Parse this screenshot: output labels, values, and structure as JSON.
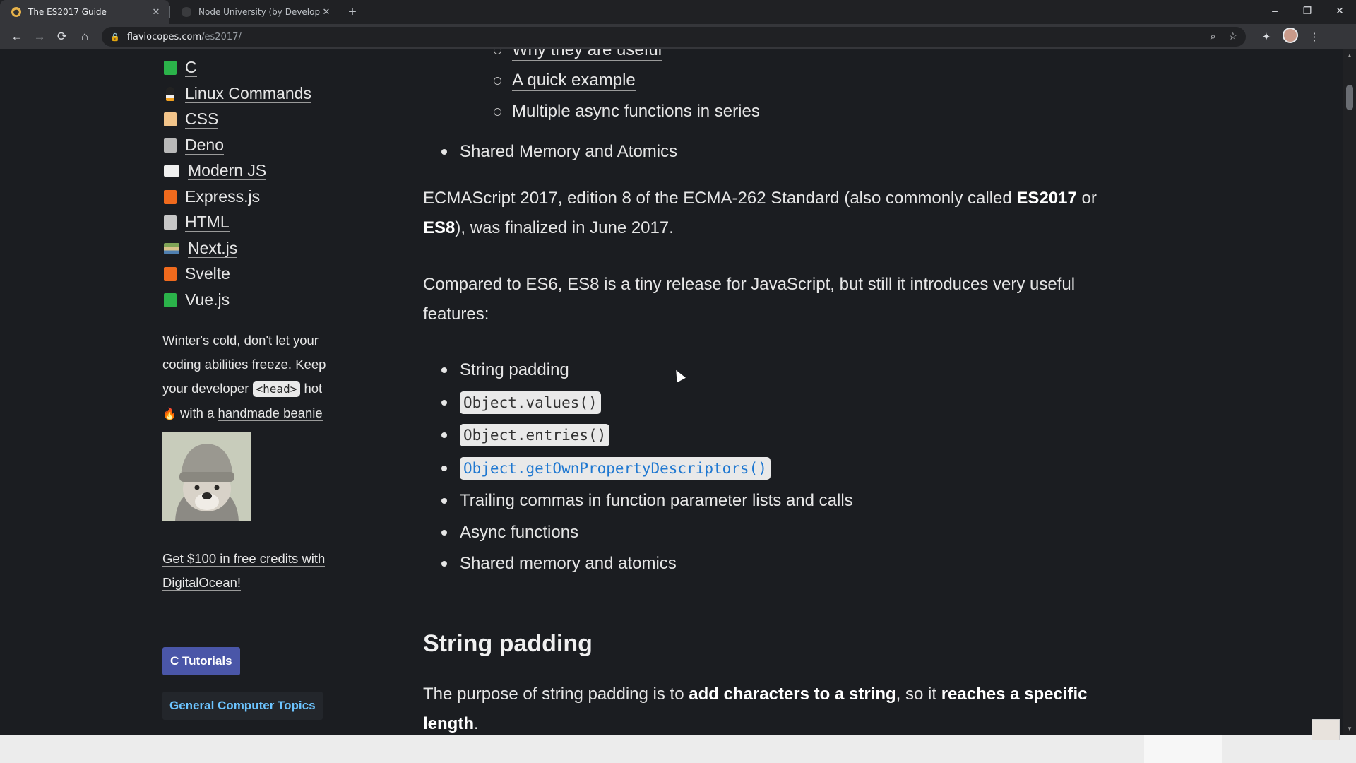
{
  "browser": {
    "tabs": [
      {
        "title": "The ES2017 Guide",
        "active": true,
        "close": "✕"
      },
      {
        "title": "Node University (by DevelopInte",
        "active": false,
        "close": "✕"
      }
    ],
    "new_tab": "+",
    "url_host": "flaviocopes.com",
    "url_path": "/es2017/",
    "window_controls": [
      "–",
      "❐",
      "✕"
    ]
  },
  "sidebar": {
    "topics": [
      {
        "label": "C",
        "icon": "green-book-icon",
        "color": "#2bb34a"
      },
      {
        "label": "Linux Commands",
        "icon": "penguin-icon",
        "color": "#444444"
      },
      {
        "label": "CSS",
        "icon": "notebook-icon",
        "color": "#f2c48a"
      },
      {
        "label": "Deno",
        "icon": "notebook-icon",
        "color": "#b9b9b9"
      },
      {
        "label": "Modern JS",
        "icon": "open-book-icon",
        "color": "#f0f0f0"
      },
      {
        "label": "Express.js",
        "icon": "orange-book-icon",
        "color": "#f06a1d"
      },
      {
        "label": "HTML",
        "icon": "notebook-icon",
        "color": "#c7c7c7"
      },
      {
        "label": "Next.js",
        "icon": "books-stack-icon",
        "color": "#7fa457"
      },
      {
        "label": "Svelte",
        "icon": "orange-book-icon",
        "color": "#f06a1d"
      },
      {
        "label": "Vue.js",
        "icon": "green-book-icon",
        "color": "#2bb34a"
      }
    ],
    "promo": {
      "text_1": "Winter's cold, don't let your coding abilities freeze. Keep your developer ",
      "code": "<head>",
      "text_2": " hot",
      "fire": "🔥",
      "text_3": " with a ",
      "link": "handmade beanie"
    },
    "image_alt": "dog-in-beanie-image",
    "credits_link": "Get $100 in free credits with DigitalOcean!",
    "button_c": "C Tutorials",
    "button_general": "General Computer Topics"
  },
  "article": {
    "toc_cutoff": "Why they are useful",
    "toc_sub": [
      "A quick example",
      "Multiple async functions in series"
    ],
    "toc_main": "Shared Memory and Atomics",
    "intro_1": "ECMAScript 2017, edition 8 of the ECMA-262 Standard (also commonly called ",
    "intro_b1": "ES2017",
    "intro_2": " or ",
    "intro_b2": "ES8",
    "intro_3": "), was finalized in June 2017.",
    "compare": "Compared to ES6, ES8 is a tiny release for JavaScript, but still it introduces very useful features:",
    "features": [
      {
        "text": "String padding",
        "code": false
      },
      {
        "text": "Object.values()",
        "code": true
      },
      {
        "text": "Object.entries()",
        "code": true
      },
      {
        "text": "Object.getOwnPropertyDescriptors()",
        "code": true,
        "highlight": true
      },
      {
        "text": "Trailing commas in function parameter lists and calls",
        "code": false
      },
      {
        "text": "Async functions",
        "code": false
      },
      {
        "text": "Shared memory and atomics",
        "code": false
      }
    ],
    "heading": "String padding",
    "padding_1": "The purpose of string padding is to ",
    "padding_b1": "add characters to a string",
    "padding_2": ", so it ",
    "padding_b2": "reaches a specific length",
    "padding_3": "."
  },
  "colors": {
    "page_bg": "#1b1d21",
    "text": "#e6e6e6",
    "code_bg": "#e9e9e9",
    "button_c": "#4a56a8",
    "link_blue": "#6cc4ff"
  }
}
